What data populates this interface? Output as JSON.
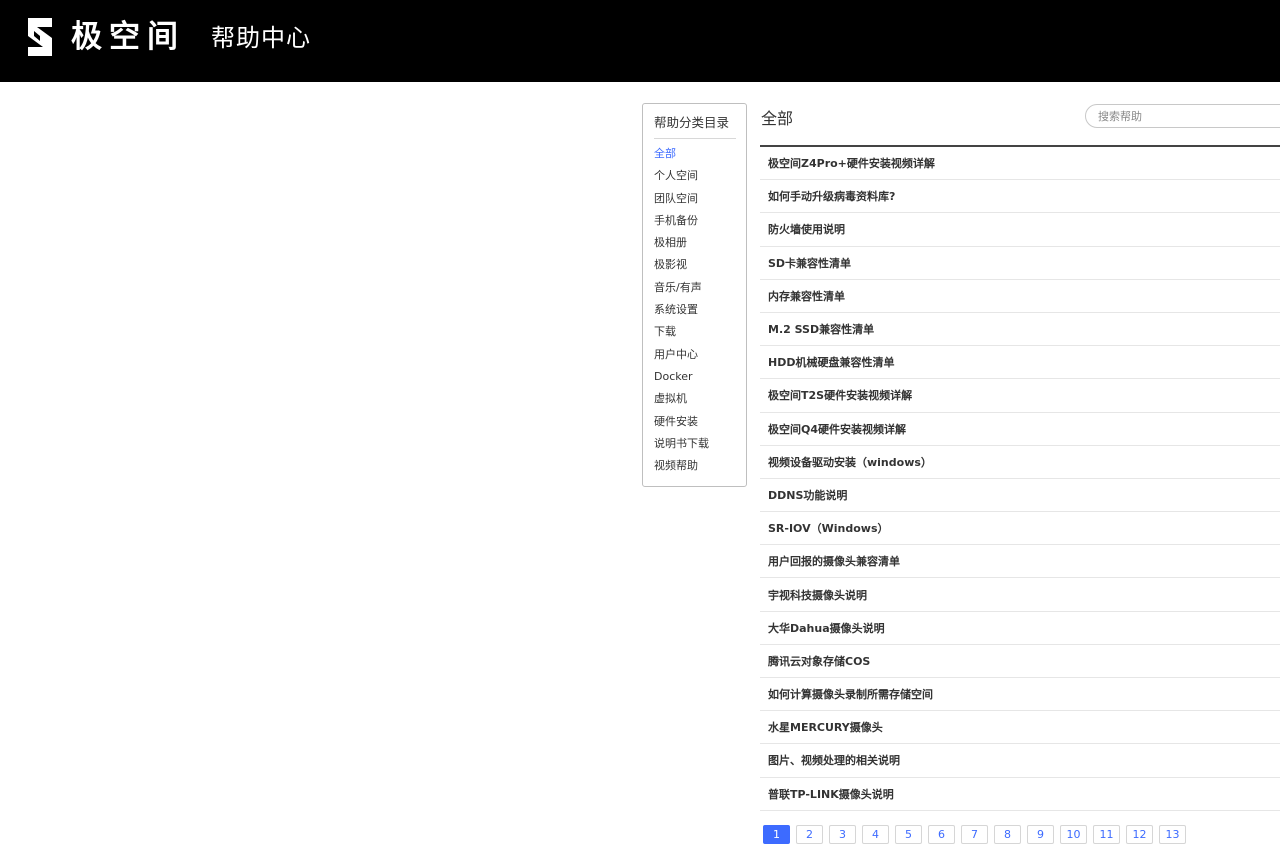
{
  "header": {
    "logo_text": "极空间",
    "title": "帮助中心"
  },
  "sidebar": {
    "title": "帮助分类目录",
    "items": [
      "全部",
      "个人空间",
      "团队空间",
      "手机备份",
      "极相册",
      "极影视",
      "音乐/有声",
      "系统设置",
      "下载",
      "用户中心",
      "Docker",
      "虚拟机",
      "硬件安装",
      "说明书下载",
      "视频帮助"
    ],
    "active_index": 0
  },
  "main": {
    "title": "全部",
    "search_placeholder": "搜索帮助",
    "articles": [
      "极空间Z4Pro+硬件安装视频详解",
      "如何手动升级病毒资料库?",
      "防火墙使用说明",
      "SD卡兼容性清单",
      "内存兼容性清单",
      "M.2 SSD兼容性清单",
      "HDD机械硬盘兼容性清单",
      "极空间T2S硬件安装视频详解",
      "极空间Q4硬件安装视频详解",
      "视频设备驱动安装（windows）",
      "DDNS功能说明",
      "SR-IOV（Windows）",
      "用户回报的摄像头兼容清单",
      "宇视科技摄像头说明",
      "大华Dahua摄像头说明",
      "腾讯云对象存储COS",
      "如何计算摄像头录制所需存储空间",
      "水星MERCURY摄像头",
      "图片、视频处理的相关说明",
      "普联TP-LINK摄像头说明"
    ]
  },
  "pagination": {
    "pages": [
      "1",
      "2",
      "3",
      "4",
      "5",
      "6",
      "7",
      "8",
      "9",
      "10",
      "11",
      "12",
      "13"
    ],
    "current_index": 0
  },
  "colors": {
    "header_bg": "#000000",
    "accent": "#3d6bff",
    "text": "#333333"
  }
}
